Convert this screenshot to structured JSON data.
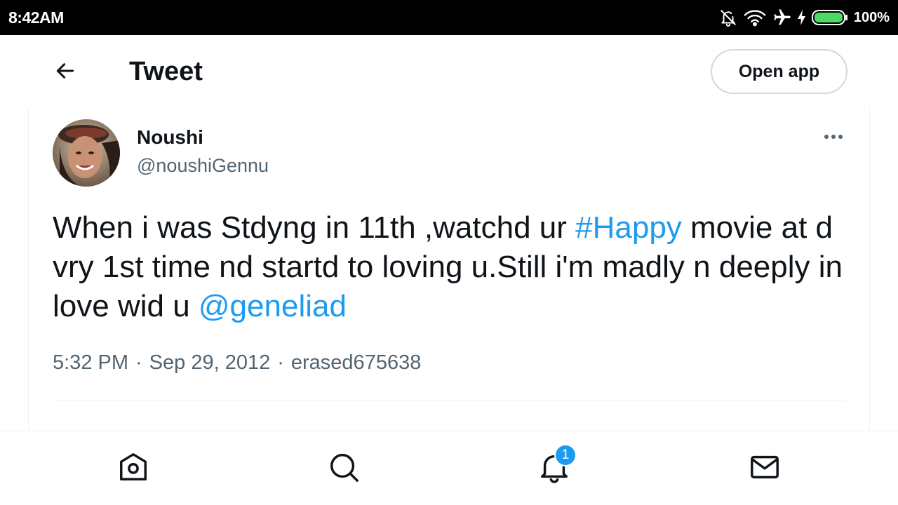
{
  "status_bar": {
    "time": "8:42AM",
    "battery_percent": "100%",
    "icons": [
      "notifications-off-icon",
      "wifi-icon",
      "airplane-icon",
      "charging-bolt-icon",
      "battery-icon"
    ]
  },
  "header": {
    "title": "Tweet",
    "back_icon": "arrow-left-icon",
    "open_app_label": "Open app"
  },
  "tweet": {
    "author": {
      "display_name": "Noushi",
      "handle": "@noushiGennu"
    },
    "more_icon": "more-horizontal-icon",
    "text_parts": {
      "part1": "When i was Stdyng in 11th ,watchd ur ",
      "hashtag": "#Happy",
      "part2": " movie at d vry 1st time nd startd to loving u.Still i'm madly n deeply in love wid u ",
      "mention": "@geneliad"
    },
    "meta": {
      "time": "5:32 PM",
      "separator": "·",
      "date": "Sep 29, 2012",
      "source": "erased675638"
    }
  },
  "bottom_nav": {
    "items": [
      {
        "icon": "home-icon"
      },
      {
        "icon": "search-icon"
      },
      {
        "icon": "bell-icon"
      },
      {
        "icon": "mail-icon"
      }
    ],
    "notification_badge": "1"
  },
  "colors": {
    "accent": "#1d9bf0",
    "text_primary": "#0f1419",
    "text_secondary": "#536471",
    "status_bar_bg": "#000000",
    "battery_green": "#4cd964"
  }
}
